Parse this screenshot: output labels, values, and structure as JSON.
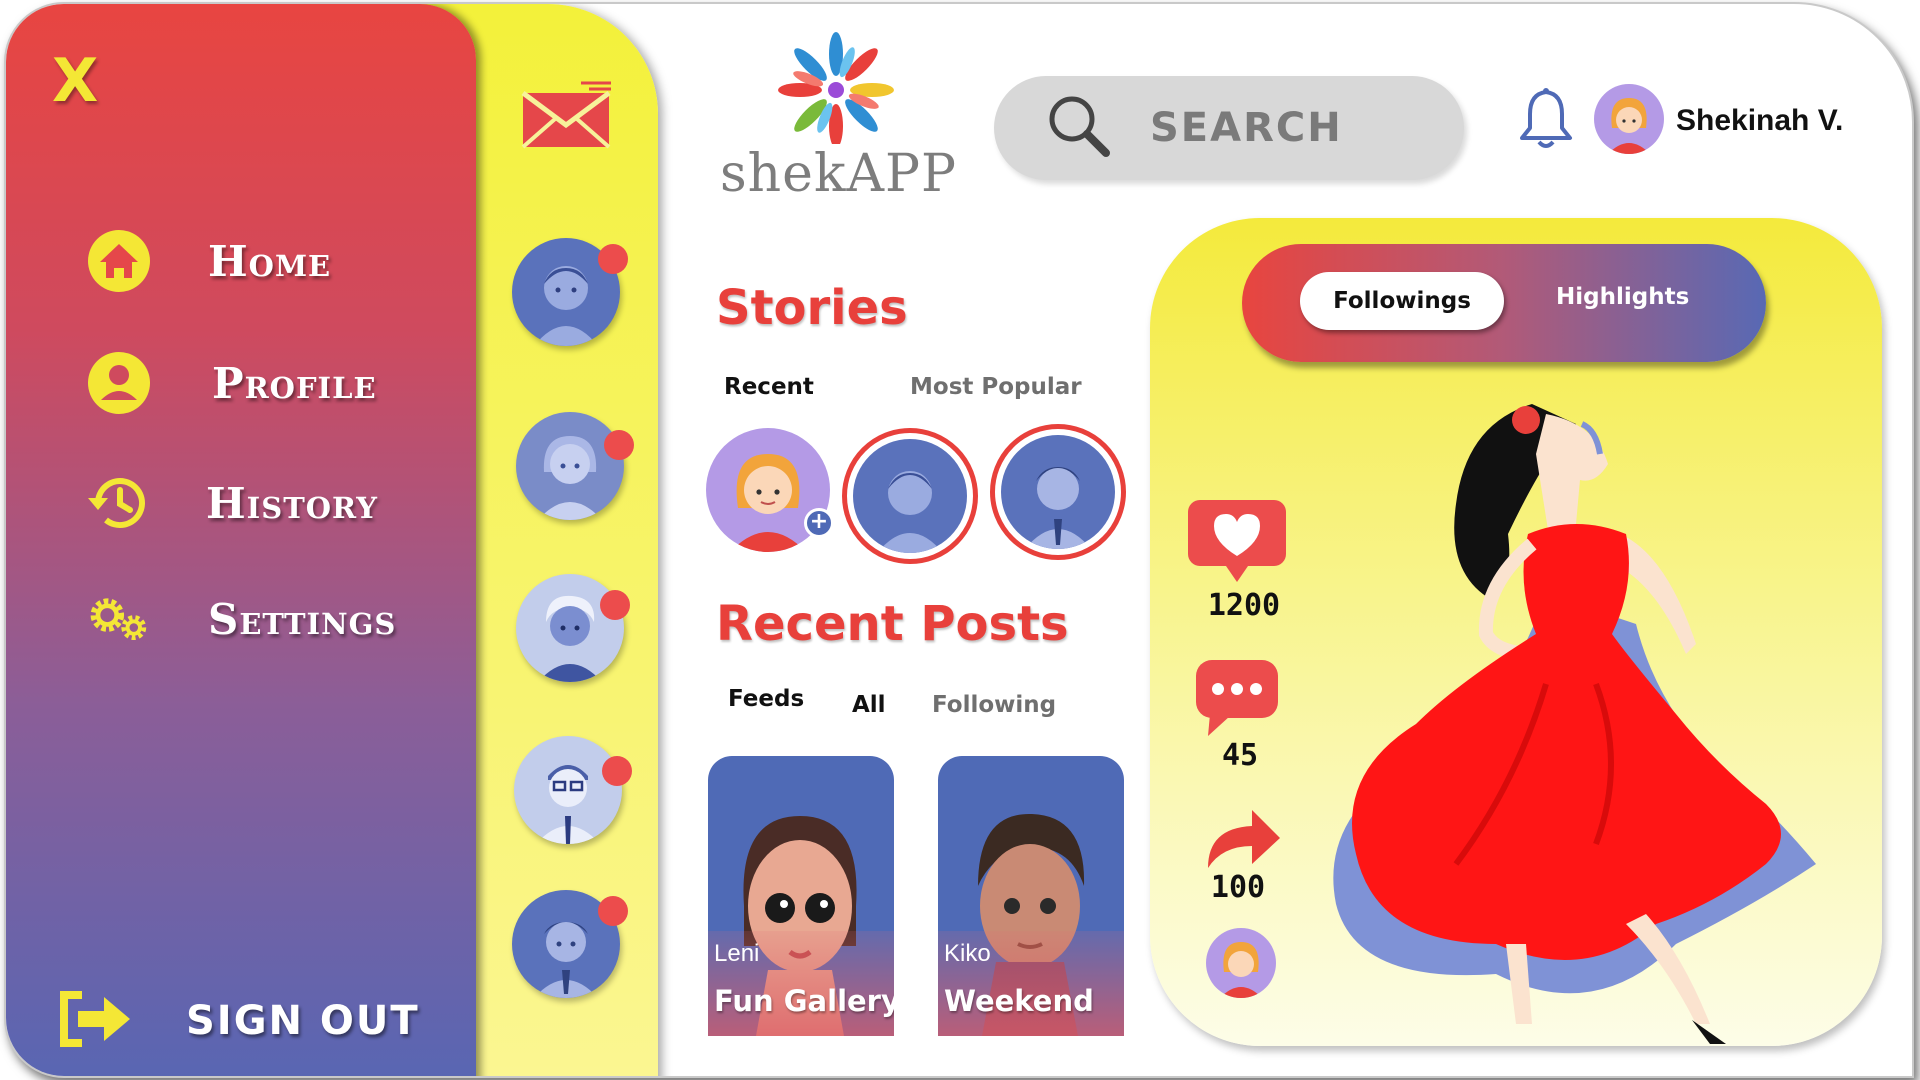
{
  "menu": {
    "close_label": "X",
    "items": [
      {
        "label": "Home",
        "icon": "home-icon"
      },
      {
        "label": "Profile",
        "icon": "user-icon"
      },
      {
        "label": "History",
        "icon": "history-icon"
      },
      {
        "label": "Settings",
        "icon": "gears-icon"
      }
    ],
    "sign_out_label": "SIGN OUT",
    "colors": {
      "top": "#e84541",
      "bottom": "#5866b3",
      "accent": "#f4e735"
    }
  },
  "messages": {
    "icon": "mail-icon",
    "contacts": [
      {
        "icon": "avatar-boy"
      },
      {
        "icon": "avatar-girl"
      },
      {
        "icon": "avatar-man-gray-hair"
      },
      {
        "icon": "avatar-man-glasses"
      },
      {
        "icon": "avatar-man-suit"
      }
    ]
  },
  "header": {
    "logo_text": "shekAPP",
    "search_placeholder": "SEARCH",
    "user_name": "Shekinah V."
  },
  "stories": {
    "title": "Stories",
    "tabs": [
      "Recent",
      "Most Popular"
    ],
    "add_badge": "+"
  },
  "recent_posts": {
    "title": "Recent Posts",
    "tabs": [
      "Feeds",
      "All",
      "Following"
    ],
    "posts": [
      {
        "author": "Leni",
        "title": "Fun Gallery"
      },
      {
        "author": "Kiko",
        "title": "Weekend"
      }
    ]
  },
  "feature": {
    "toggle": {
      "active": "Followings",
      "inactive": "Highlights"
    },
    "stats": {
      "likes": "1200",
      "comments": "45",
      "shares": "100"
    }
  }
}
